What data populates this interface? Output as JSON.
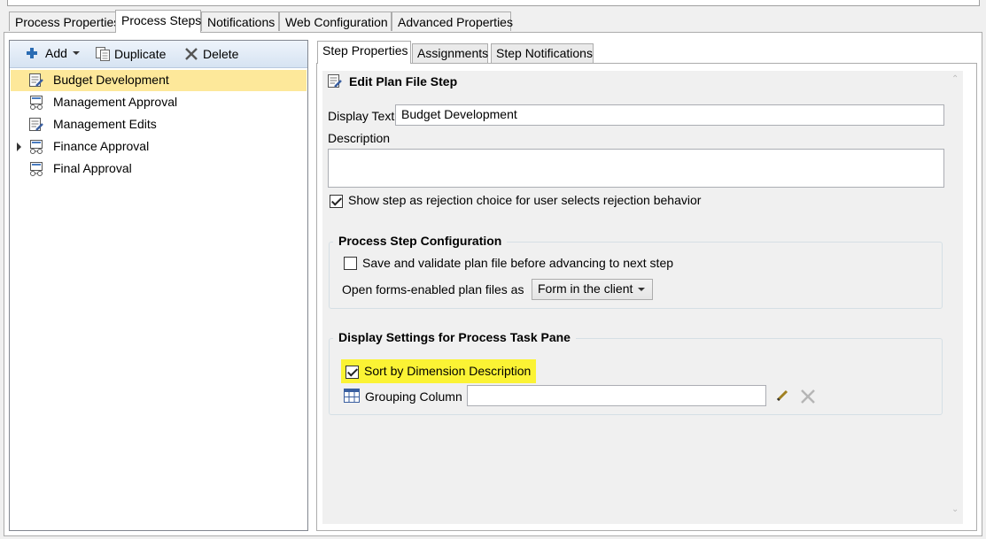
{
  "top_tabs": [
    {
      "label": "Process Properties"
    },
    {
      "label": "Process Steps"
    },
    {
      "label": "Notifications"
    },
    {
      "label": "Web Configuration"
    },
    {
      "label": "Advanced Properties"
    }
  ],
  "toolbar": {
    "add_label": "Add",
    "duplicate_label": "Duplicate",
    "delete_label": "Delete"
  },
  "tree": {
    "items": [
      {
        "label": "Budget Development",
        "icon": "edit-plan-file-icon"
      },
      {
        "label": "Management Approval",
        "icon": "approval-icon"
      },
      {
        "label": "Management Edits",
        "icon": "edit-plan-file-icon"
      },
      {
        "label": "Finance Approval",
        "icon": "approval-icon"
      },
      {
        "label": "Final Approval",
        "icon": "approval-icon"
      }
    ]
  },
  "sub_tabs": [
    {
      "label": "Step Properties"
    },
    {
      "label": "Assignments"
    },
    {
      "label": "Step Notifications"
    }
  ],
  "step": {
    "header": "Edit Plan File Step",
    "display_text_label": "Display Text",
    "display_text_value": "Budget Development",
    "description_label": "Description",
    "description_value": "",
    "rejection_checkbox_label": "Show step as rejection choice for user selects rejection behavior",
    "rejection_checked": true
  },
  "process_config": {
    "title": "Process Step Configuration",
    "save_validate_label": "Save and validate plan file before advancing to next step",
    "save_validate_checked": false,
    "open_forms_label": "Open forms-enabled plan files as",
    "open_forms_value": "Form in the client"
  },
  "display_settings": {
    "title": "Display Settings for Process Task Pane",
    "sort_label": "Sort by Dimension Description",
    "sort_checked": true,
    "grouping_label": "Grouping Column",
    "grouping_value": ""
  },
  "colors": {
    "selection": "#fde89a",
    "highlight": "#fbf334",
    "toolbar_gradient_top": "#eef4fb",
    "toolbar_gradient_bottom": "#d6e3f2"
  }
}
